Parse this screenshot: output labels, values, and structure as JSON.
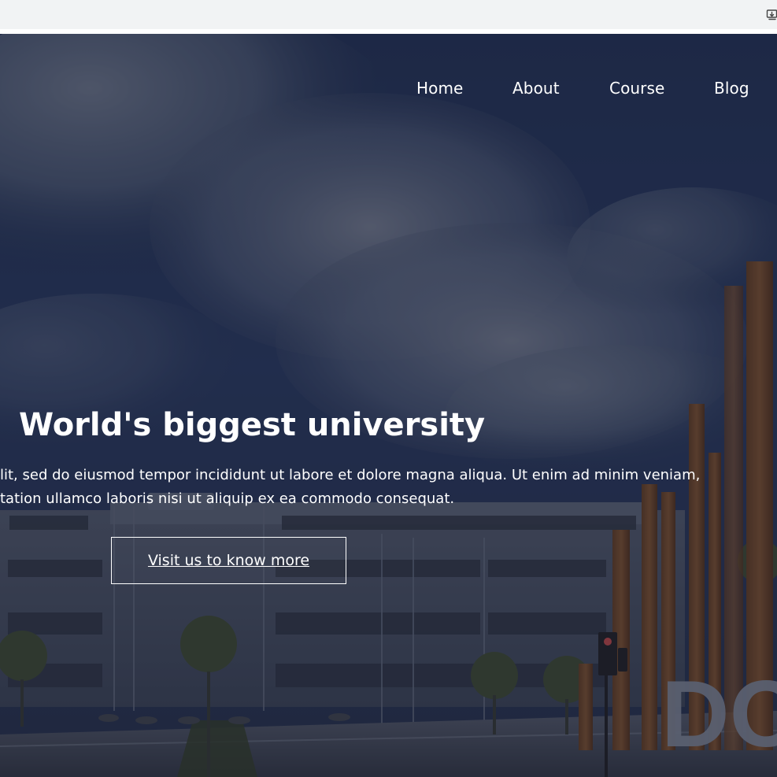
{
  "browser": {
    "install_icon": "install-app-icon"
  },
  "nav": {
    "items": [
      {
        "label": "Home"
      },
      {
        "label": "About"
      },
      {
        "label": "Course"
      },
      {
        "label": "Blog"
      }
    ]
  },
  "hero": {
    "title": "World's biggest university",
    "line1": "lit, sed do eiusmod tempor incididunt ut labore et dolore magna aliqua. Ut enim ad minim veniam,",
    "line2": "tation ullamco laboris nisi ut aliquip ex ea commodo consequat.",
    "button_label": "Visit us to know more"
  },
  "colors": {
    "toolbar": "#f1f3f4",
    "overlay": "#121626",
    "text": "#ffffff"
  }
}
